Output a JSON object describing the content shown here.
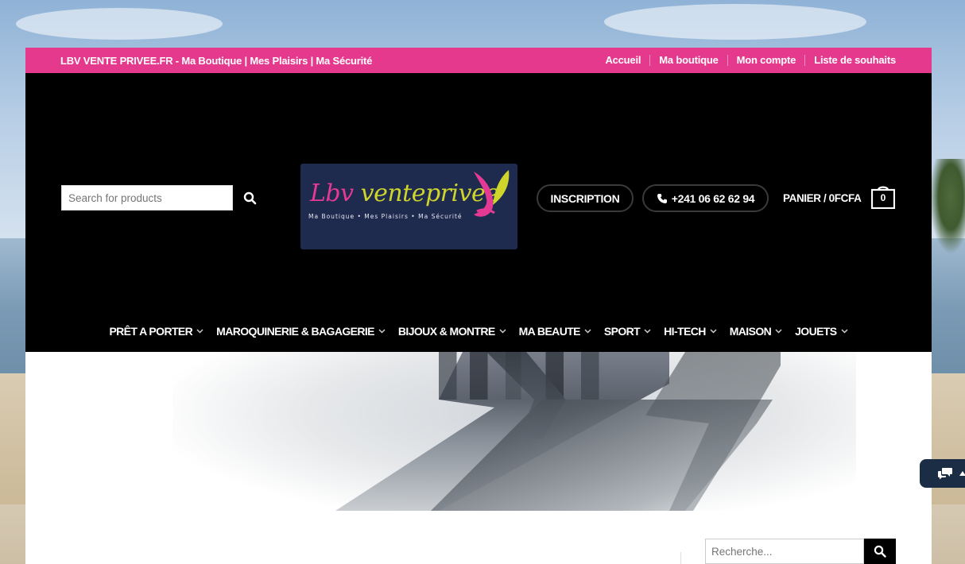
{
  "topbar": {
    "tagline": "LBV VENTE PRIVEE.FR - Ma Boutique | Mes Plaisirs | Ma Sécurité",
    "links": [
      "Accueil",
      "Ma boutique",
      "Mon compte",
      "Liste de souhaits"
    ]
  },
  "header": {
    "search_placeholder": "Search for products",
    "search_icon": "search-icon",
    "logo": {
      "part1": "Lbv",
      "part2": "venteprivee",
      "tagline": "Ma Boutique • Mes Plaisirs • Ma Sécurité"
    },
    "inscription_label": "INSCRIPTION",
    "phone_label": "+241 06 62 62 94",
    "phone_icon": "phone-icon",
    "cart_label": "PANIER / 0FCFA",
    "cart_count": "0"
  },
  "nav": {
    "items": [
      "PRÊT A PORTER",
      "MAROQUINERIE & BAGAGERIE",
      "BIJOUX & MONTRE",
      "MA BEAUTE",
      "SPORT",
      "HI-TECH",
      "MAISON",
      "JOUETS"
    ]
  },
  "sidebar": {
    "search_placeholder": "Recherche..."
  },
  "colors": {
    "brand_pink": "#e5398d",
    "header_bg": "#000000",
    "logo_bg": "#1f2a4f",
    "logo_green": "#cfd52b",
    "chat_bg": "#1b2d45"
  }
}
